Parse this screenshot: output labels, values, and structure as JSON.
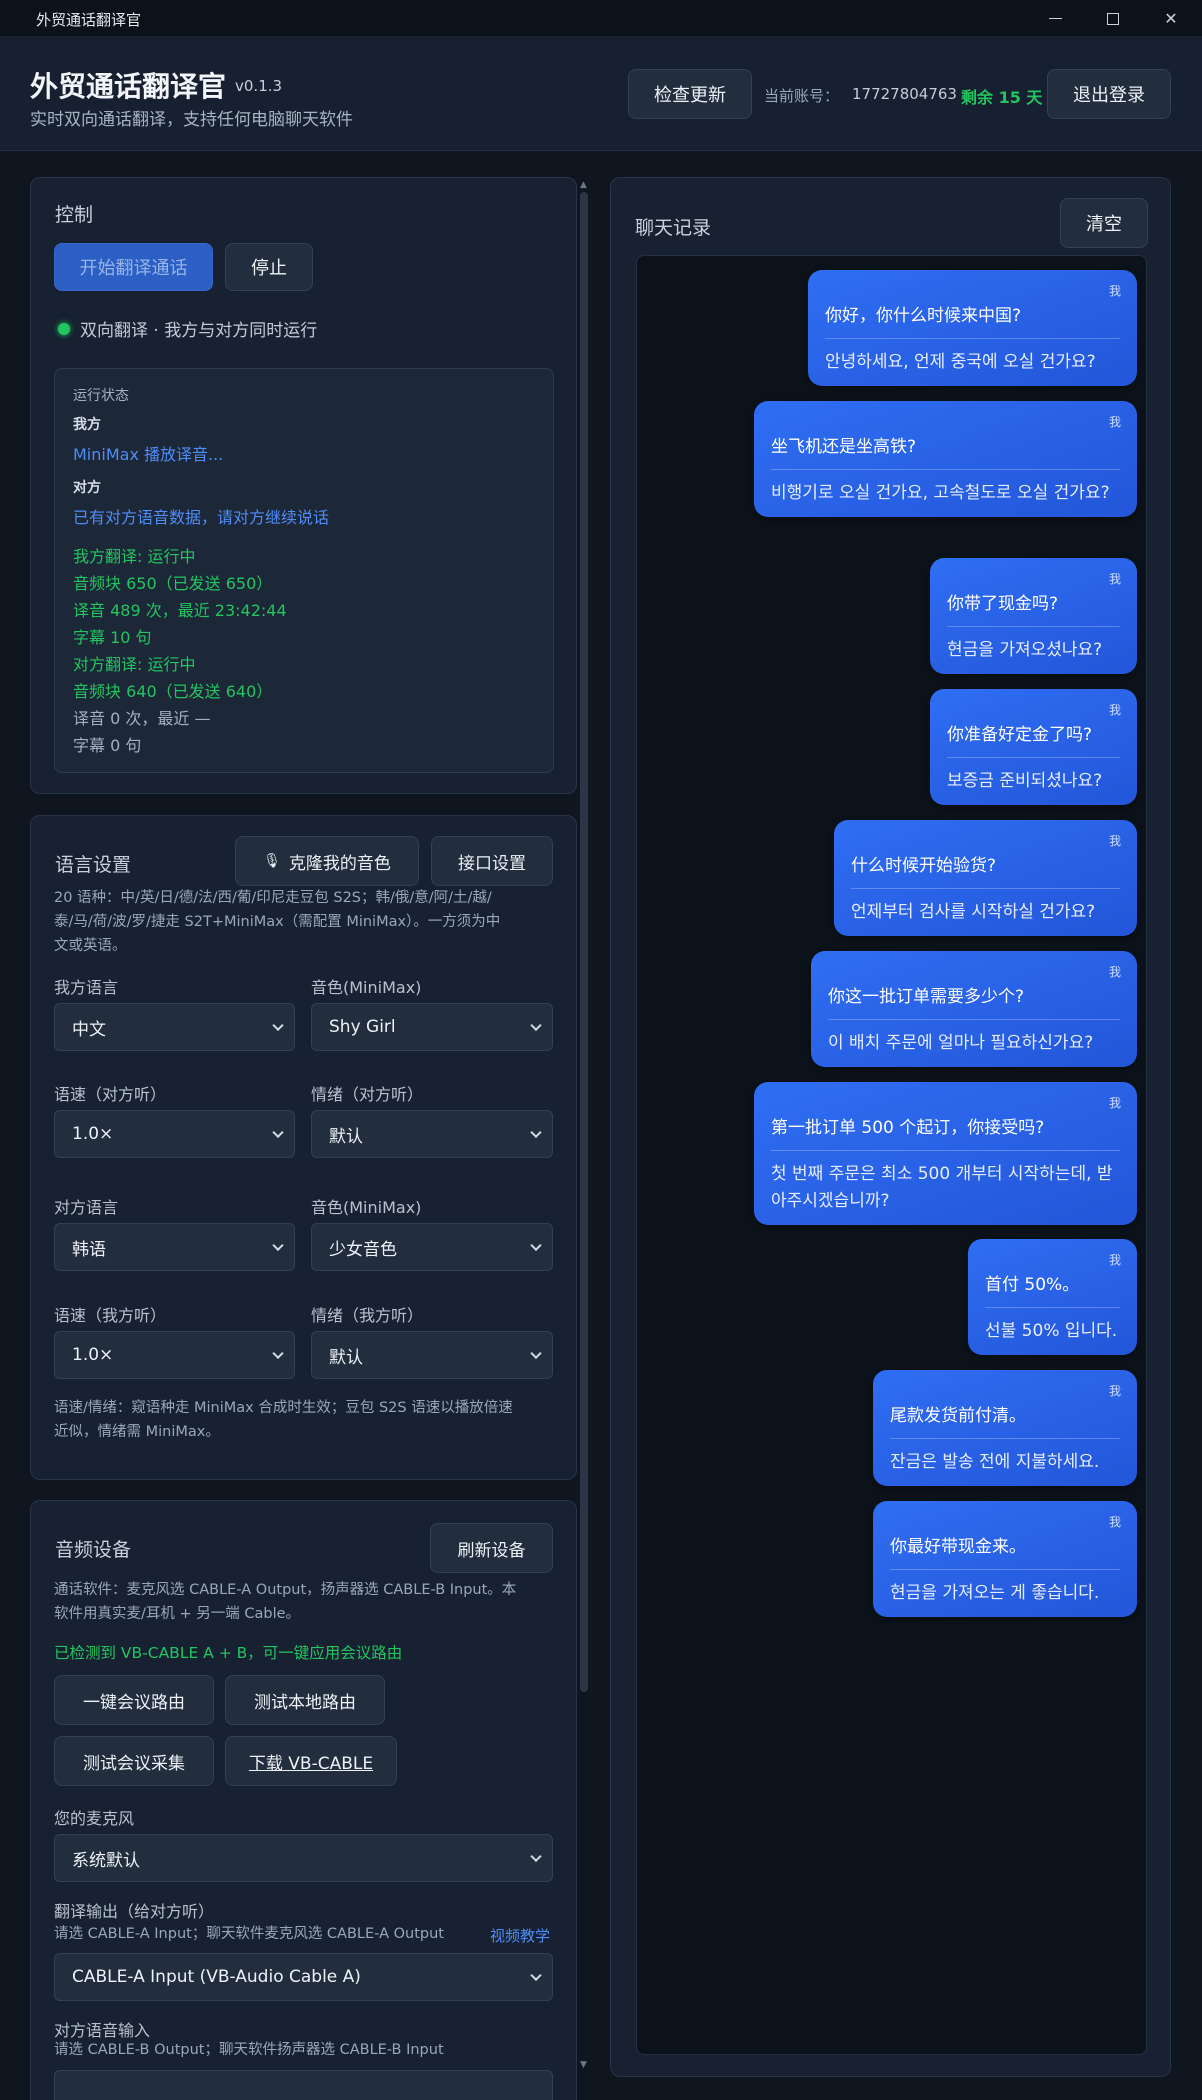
{
  "window": {
    "title": "外贸通话翻译官",
    "controls": [
      "minimize",
      "maximize",
      "close"
    ]
  },
  "header": {
    "app_title": "外贸通话翻译官",
    "version": "v0.1.3",
    "subtitle": "实时双向通话翻译，支持任何电脑聊天软件",
    "check_update": "检查更新",
    "account_label": "当前账号：",
    "account_number": "17727804763",
    "remaining": "剩余 15 天",
    "logout": "退出登录"
  },
  "control": {
    "title": "控制",
    "start_button": "开始翻译通话",
    "stop_button": "停止",
    "status_text": "双向翻译 · 我方与对方同时运行",
    "run_status": {
      "title": "运行状态",
      "self_label": "我方",
      "self_status": "MiniMax 播放译音...",
      "peer_label": "对方",
      "peer_status": "已有对方语音数据，请对方继续说话",
      "lines": [
        "我方翻译: 运行中",
        "音频块 650（已发送 650）",
        "译音 489 次，最近 23:42:44",
        "字幕 10 句",
        "对方翻译: 运行中",
        "音频块 640（已发送 640）",
        "译音 0 次，最近 —",
        "字幕 0 句"
      ]
    }
  },
  "language": {
    "title": "语言设置",
    "clone_button": "克隆我的音色",
    "api_button": "接口设置",
    "note": [
      "20 语种：中/英/日/德/法/西/葡/印尼走豆包 S2S；韩/俄/意/阿/土/越/",
      "泰/马/荷/波/罗/捷走 S2T+MiniMax（需配置 MiniMax）。一方须为中",
      "文或英语。"
    ],
    "fields": {
      "my_lang_label": "我方语言",
      "my_lang_value": "中文",
      "voice1_label": "音色(MiniMax)",
      "voice1_value": "Shy Girl",
      "speed1_label": "语速（对方听）",
      "speed1_value": "1.0×",
      "emotion1_label": "情绪（对方听）",
      "emotion1_value": "默认",
      "peer_lang_label": "对方语言",
      "peer_lang_value": "韩语",
      "voice2_label": "音色(MiniMax)",
      "voice2_value": "少女音色",
      "speed2_label": "语速（我方听）",
      "speed2_value": "1.0×",
      "emotion2_label": "情绪（我方听）",
      "emotion2_value": "默认"
    },
    "footer_note": [
      "语速/情绪：窥语种走 MiniMax 合成时生效；豆包 S2S 语速以播放倍速",
      "近似，情绪需 MiniMax。"
    ]
  },
  "audio": {
    "title": "音频设备",
    "refresh_button": "刷新设备",
    "note": [
      "通话软件：麦克风选 CABLE-A Output，扬声器选 CABLE-B Input。本",
      "软件用真实麦/耳机 + 另一端 Cable。"
    ],
    "detected": "已检测到 VB-CABLE A + B，可一键应用会议路由",
    "btn_meeting_route": "一键会议路由",
    "btn_test_local": "测试本地路由",
    "btn_test_capture": "测试会议采集",
    "btn_download": "下载 VB-CABLE",
    "mic_label": "您的麦克风",
    "mic_value": "系统默认",
    "output_label": "翻译输出（给对方听）",
    "output_hint": "请选 CABLE-A Input；聊天软件麦克风选 CABLE-A Output",
    "video_link": "视频教学",
    "output_value": "CABLE-A Input (VB-Audio Cable A)",
    "peer_input_label": "对方语音输入",
    "peer_input_hint": "请选 CABLE-B Output；聊天软件扬声器选 CABLE-B Input"
  },
  "chat": {
    "title": "聊天记录",
    "clear_button": "清空",
    "messages": [
      {
        "who": "我",
        "src": "你好，你什么时候来中国?",
        "dst": "안녕하세요, 언제 중국에 오실 건가요?"
      },
      {
        "who": "我",
        "src": "坐飞机还是坐高铁?",
        "dst": "비행기로 오실 건가요, 고속철도로 오실 건가요?"
      },
      {
        "who": "我",
        "src": "你带了现金吗?",
        "dst": "현금을 가져오셨나요?"
      },
      {
        "who": "我",
        "src": "你准备好定金了吗?",
        "dst": "보증금 준비되셨나요?"
      },
      {
        "who": "我",
        "src": "什么时候开始验货?",
        "dst": "언제부터 검사를 시작하실 건가요?"
      },
      {
        "who": "我",
        "src": "你这一批订单需要多少个?",
        "dst": "이 배치 주문에 얼마나 필요하신가요?"
      },
      {
        "who": "我",
        "src": "第一批订单 500 个起订，你接受吗?",
        "dst": "첫 번째 주문은 최소 500 개부터 시작하는데, 받아주시겠습니까?"
      },
      {
        "who": "我",
        "src": "首付 50%。",
        "dst": "선불 50% 입니다."
      },
      {
        "who": "我",
        "src": "尾款发货前付清。",
        "dst": "잔금은 발송 전에 지불하세요."
      },
      {
        "who": "我",
        "src": "你最好带现金来。",
        "dst": "현금을 가져오는 게 좋습니다."
      }
    ]
  }
}
